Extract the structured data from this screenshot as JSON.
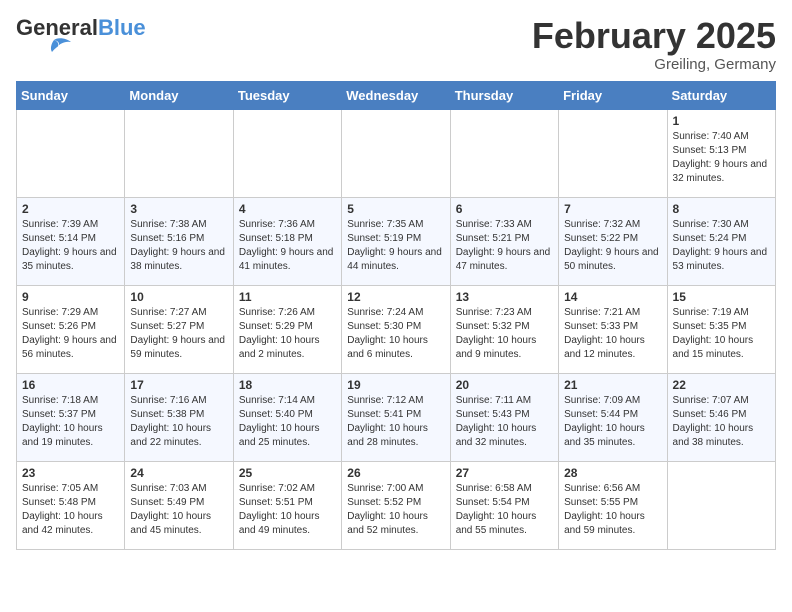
{
  "header": {
    "logo_general": "General",
    "logo_blue": "Blue",
    "month_title": "February 2025",
    "location": "Greiling, Germany"
  },
  "days_of_week": [
    "Sunday",
    "Monday",
    "Tuesday",
    "Wednesday",
    "Thursday",
    "Friday",
    "Saturday"
  ],
  "weeks": [
    [
      {
        "day": "",
        "info": ""
      },
      {
        "day": "",
        "info": ""
      },
      {
        "day": "",
        "info": ""
      },
      {
        "day": "",
        "info": ""
      },
      {
        "day": "",
        "info": ""
      },
      {
        "day": "",
        "info": ""
      },
      {
        "day": "1",
        "info": "Sunrise: 7:40 AM\nSunset: 5:13 PM\nDaylight: 9 hours and 32 minutes."
      }
    ],
    [
      {
        "day": "2",
        "info": "Sunrise: 7:39 AM\nSunset: 5:14 PM\nDaylight: 9 hours and 35 minutes."
      },
      {
        "day": "3",
        "info": "Sunrise: 7:38 AM\nSunset: 5:16 PM\nDaylight: 9 hours and 38 minutes."
      },
      {
        "day": "4",
        "info": "Sunrise: 7:36 AM\nSunset: 5:18 PM\nDaylight: 9 hours and 41 minutes."
      },
      {
        "day": "5",
        "info": "Sunrise: 7:35 AM\nSunset: 5:19 PM\nDaylight: 9 hours and 44 minutes."
      },
      {
        "day": "6",
        "info": "Sunrise: 7:33 AM\nSunset: 5:21 PM\nDaylight: 9 hours and 47 minutes."
      },
      {
        "day": "7",
        "info": "Sunrise: 7:32 AM\nSunset: 5:22 PM\nDaylight: 9 hours and 50 minutes."
      },
      {
        "day": "8",
        "info": "Sunrise: 7:30 AM\nSunset: 5:24 PM\nDaylight: 9 hours and 53 minutes."
      }
    ],
    [
      {
        "day": "9",
        "info": "Sunrise: 7:29 AM\nSunset: 5:26 PM\nDaylight: 9 hours and 56 minutes."
      },
      {
        "day": "10",
        "info": "Sunrise: 7:27 AM\nSunset: 5:27 PM\nDaylight: 9 hours and 59 minutes."
      },
      {
        "day": "11",
        "info": "Sunrise: 7:26 AM\nSunset: 5:29 PM\nDaylight: 10 hours and 2 minutes."
      },
      {
        "day": "12",
        "info": "Sunrise: 7:24 AM\nSunset: 5:30 PM\nDaylight: 10 hours and 6 minutes."
      },
      {
        "day": "13",
        "info": "Sunrise: 7:23 AM\nSunset: 5:32 PM\nDaylight: 10 hours and 9 minutes."
      },
      {
        "day": "14",
        "info": "Sunrise: 7:21 AM\nSunset: 5:33 PM\nDaylight: 10 hours and 12 minutes."
      },
      {
        "day": "15",
        "info": "Sunrise: 7:19 AM\nSunset: 5:35 PM\nDaylight: 10 hours and 15 minutes."
      }
    ],
    [
      {
        "day": "16",
        "info": "Sunrise: 7:18 AM\nSunset: 5:37 PM\nDaylight: 10 hours and 19 minutes."
      },
      {
        "day": "17",
        "info": "Sunrise: 7:16 AM\nSunset: 5:38 PM\nDaylight: 10 hours and 22 minutes."
      },
      {
        "day": "18",
        "info": "Sunrise: 7:14 AM\nSunset: 5:40 PM\nDaylight: 10 hours and 25 minutes."
      },
      {
        "day": "19",
        "info": "Sunrise: 7:12 AM\nSunset: 5:41 PM\nDaylight: 10 hours and 28 minutes."
      },
      {
        "day": "20",
        "info": "Sunrise: 7:11 AM\nSunset: 5:43 PM\nDaylight: 10 hours and 32 minutes."
      },
      {
        "day": "21",
        "info": "Sunrise: 7:09 AM\nSunset: 5:44 PM\nDaylight: 10 hours and 35 minutes."
      },
      {
        "day": "22",
        "info": "Sunrise: 7:07 AM\nSunset: 5:46 PM\nDaylight: 10 hours and 38 minutes."
      }
    ],
    [
      {
        "day": "23",
        "info": "Sunrise: 7:05 AM\nSunset: 5:48 PM\nDaylight: 10 hours and 42 minutes."
      },
      {
        "day": "24",
        "info": "Sunrise: 7:03 AM\nSunset: 5:49 PM\nDaylight: 10 hours and 45 minutes."
      },
      {
        "day": "25",
        "info": "Sunrise: 7:02 AM\nSunset: 5:51 PM\nDaylight: 10 hours and 49 minutes."
      },
      {
        "day": "26",
        "info": "Sunrise: 7:00 AM\nSunset: 5:52 PM\nDaylight: 10 hours and 52 minutes."
      },
      {
        "day": "27",
        "info": "Sunrise: 6:58 AM\nSunset: 5:54 PM\nDaylight: 10 hours and 55 minutes."
      },
      {
        "day": "28",
        "info": "Sunrise: 6:56 AM\nSunset: 5:55 PM\nDaylight: 10 hours and 59 minutes."
      },
      {
        "day": "",
        "info": ""
      }
    ]
  ]
}
